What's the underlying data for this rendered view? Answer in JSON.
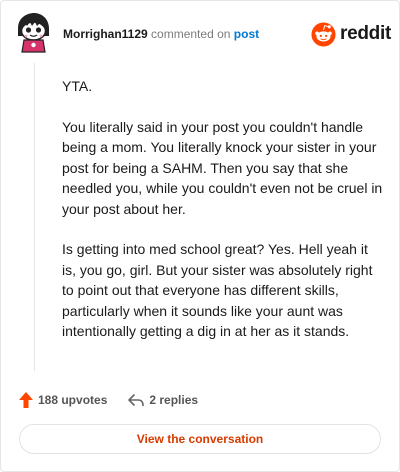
{
  "header": {
    "username": "Morrighan1129",
    "commented_text": "commented on",
    "post_link": "post"
  },
  "brand": {
    "wordmark": "reddit",
    "icon": "reddit-snoo-icon",
    "color": "#ff4500"
  },
  "avatar": {
    "icon": "snoo-avatar-icon"
  },
  "comment": {
    "paragraphs": [
      "YTA.",
      "You literally said in your post you couldn't handle being a mom. You literally knock your sister in your post for being a SAHM. Then you say that she needled you, while you couldn't even not be cruel in your post about her.",
      "Is getting into med school great? Yes. Hell yeah it is, you go, girl. But your sister was absolutely right to point out that everyone has different skills, particularly when it sounds like your aunt was intentionally getting a dig in at her as it stands."
    ]
  },
  "footer": {
    "upvotes_label": "188 upvotes",
    "upvote_icon": "upvote-arrow-icon",
    "upvote_color": "#ff4500",
    "replies_label": "2 replies",
    "reply_icon": "reply-arrow-icon"
  },
  "cta": {
    "view_label": "View the conversation",
    "color": "#d93a00"
  }
}
